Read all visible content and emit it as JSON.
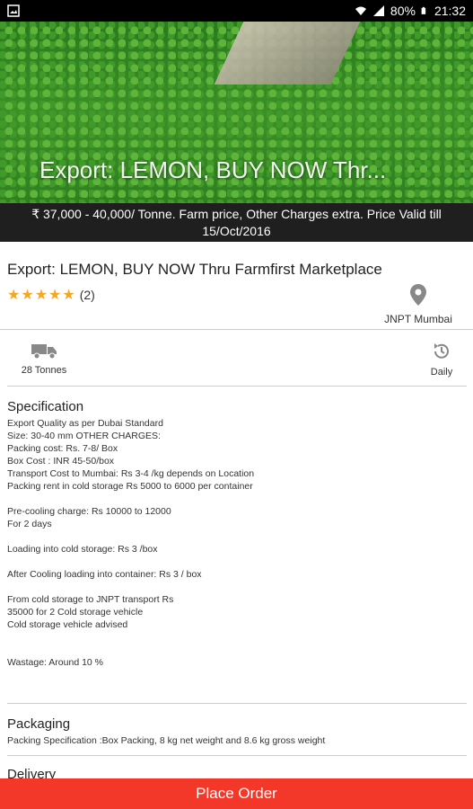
{
  "status_bar": {
    "battery": "80%",
    "time": "21:32"
  },
  "hero": {
    "overlay_title": "Export: LEMON, BUY NOW Thr..."
  },
  "price_bar": {
    "text": "₹ 37,000 - 40,000/ Tonne. Farm price, Other Charges extra. Price Valid till 15/Oct/2016"
  },
  "product": {
    "title": "Export: LEMON, BUY NOW Thru Farmfirst Marketplace",
    "rating_stars": 5,
    "rating_count": "(2)",
    "location": "JNPT Mumbai"
  },
  "stats": {
    "quantity": "28 Tonnes",
    "frequency": "Daily"
  },
  "specification": {
    "heading": "Specification",
    "body": "Export Quality as per Dubai Standard\nSize: 30-40 mm  OTHER CHARGES:\nPacking cost: Rs. 7-8/ Box\nBox Cost : INR 45-50/box\nTransport Cost to Mumbai: Rs 3-4 /kg depends on Location\nPacking rent in cold storage Rs 5000 to 6000 per container\n\nPre-cooling charge: Rs 10000 to 12000\n For 2 days\n\nLoading into cold storage: Rs 3 /box\n\nAfter Cooling loading into container: Rs 3 / box\n\nFrom cold storage to JNPT transport Rs\n35000 for 2 Cold storage vehicle\nCold storage vehicle advised\n\n\nWastage: Around  10 %"
  },
  "packaging": {
    "heading": "Packaging",
    "body": "Packing  Specification :Box Packing,   8 kg net weight and 8.6 kg gross weight"
  },
  "delivery": {
    "heading": "Delivery"
  },
  "actions": {
    "place_order": "Place Order"
  },
  "colors": {
    "accent": "#f3382a",
    "star": "#f5a623",
    "price_bar_bg": "#1f1f1f"
  }
}
